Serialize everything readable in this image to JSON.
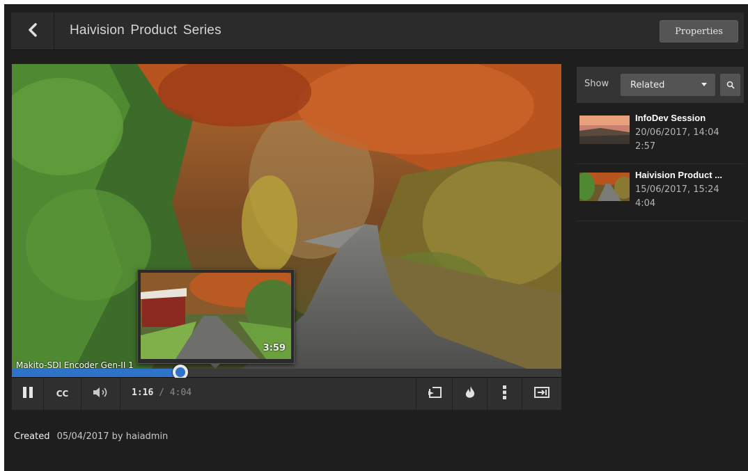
{
  "header": {
    "title": "Haivision Product Series",
    "properties_label": "Properties",
    "back_icon": "chevron-left-icon"
  },
  "player": {
    "chapter_label": "Makito-SDI Encoder Gen-II 1",
    "preview_time": "3:59",
    "progress_fraction": 0.307,
    "time_current": "1:16",
    "time_separator": "/",
    "time_total": "4:04",
    "cc_label": "CC",
    "icons": [
      "pause-icon",
      "volume-icon",
      "share-icon",
      "flame-icon",
      "more-vertical-icon",
      "theater-mode-icon"
    ]
  },
  "created": {
    "label": "Created",
    "date": "05/04/2017",
    "by": "by haiadmin"
  },
  "sidebar": {
    "show_label": "Show",
    "select_value": "Related",
    "items": [
      {
        "title": "InfoDev Session",
        "date": "20/06/2017, 14:04",
        "duration": "2:57"
      },
      {
        "title": "Haivision Product ...",
        "date": "15/06/2017, 15:24",
        "duration": "4:04"
      }
    ]
  },
  "colors": {
    "accent": "#2f73c8",
    "background": "#1e1e1e",
    "header": "#2b2b2b"
  }
}
